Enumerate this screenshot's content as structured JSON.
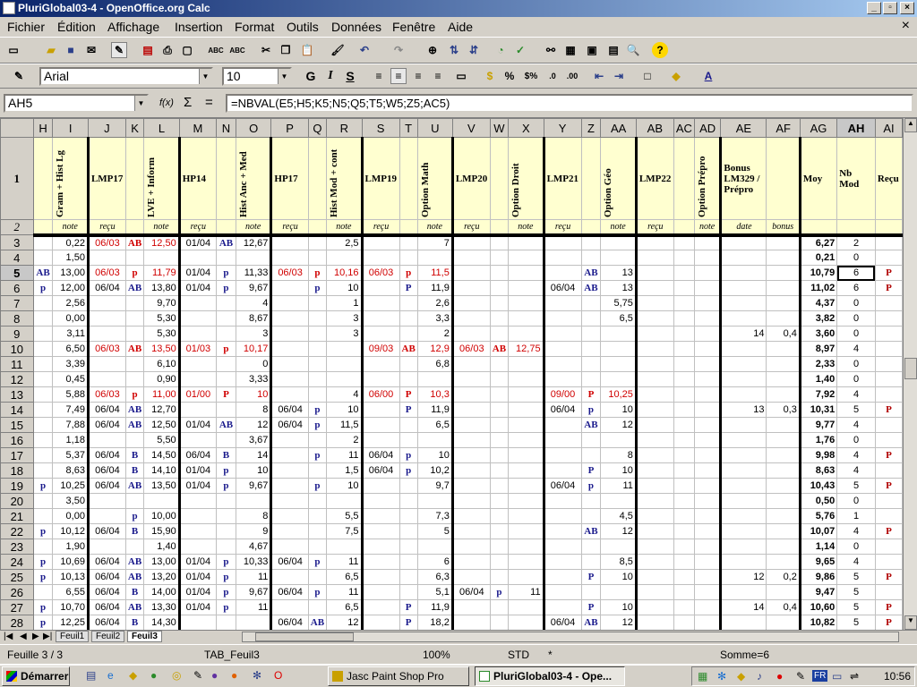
{
  "window": {
    "title": "PluriGlobal03-4 - OpenOffice.org Calc"
  },
  "menu": [
    "Fichier",
    "Édition",
    "Affichage",
    "Insertion",
    "Format",
    "Outils",
    "Données",
    "Fenêtre",
    "Aide"
  ],
  "format_bar": {
    "font": "Arial",
    "size": "10",
    "bold": "G",
    "italic": "I",
    "underline": "S",
    "percent": "%",
    "currency": "$%"
  },
  "formula_bar": {
    "cell_ref": "AH5",
    "fx": "f(x)",
    "sigma": "Σ",
    "equals": "=",
    "formula": "=NBVAL(E5;H5;K5;N5;Q5;T5;W5;Z5;AC5)"
  },
  "columns": [
    "H",
    "I",
    "J",
    "K",
    "L",
    "M",
    "N",
    "O",
    "P",
    "Q",
    "R",
    "S",
    "T",
    "U",
    "V",
    "W",
    "X",
    "Y",
    "Z",
    "AA",
    "AB",
    "AC",
    "AD",
    "AE",
    "AF",
    "AG",
    "AH",
    "AI"
  ],
  "header_row1": {
    "I": "Gram + Hist Lg",
    "J": "LMP17",
    "L": "LVE + Inform",
    "M": "HP14",
    "O": "Hist Anc + Med",
    "P": "HP17",
    "R": "Hist Mod + cont",
    "S": "LMP19",
    "U": "Option Math",
    "V": "LMP20",
    "X": "Option Droit",
    "Y": "LMP21",
    "AA": "Option Géo",
    "AB": "LMP22",
    "AD": "Option Prépro",
    "AE": "Bonus LM329 / Prépro",
    "AG": "Moy",
    "AH": "Nb Mod",
    "AI": "Reçu"
  },
  "header_row2": {
    "I": "note",
    "J": "reçu",
    "L": "note",
    "M": "reçu",
    "O": "note",
    "P": "reçu",
    "R": "note",
    "S": "reçu",
    "U": "note",
    "V": "reçu",
    "X": "note",
    "Y": "reçu",
    "AA": "note",
    "AB": "reçu",
    "AD": "note",
    "AE": "date",
    "AF": "bonus"
  },
  "rows": [
    {
      "n": "3",
      "I": "0,22",
      "J": "06/03",
      "K": "AB",
      "L": "12,50",
      "M": "01/04",
      "N": "AB",
      "O": "12,67",
      "R": "2,5",
      "U": "7",
      "AG": "6,27",
      "AH": "2"
    },
    {
      "n": "4",
      "I": "1,50",
      "AG": "0,21",
      "AH": "0"
    },
    {
      "n": "5",
      "H": "AB",
      "I": "13,00",
      "J": "06/03",
      "K": "p",
      "L": "11,79",
      "M": "01/04",
      "N": "p",
      "O": "11,33",
      "P": "06/03",
      "Q": "p",
      "R": "10,16",
      "S": "06/03",
      "T": "p",
      "U": "11,5",
      "Z": "AB",
      "AA": "13",
      "AG": "10,79",
      "AH": "6",
      "AI": "P"
    },
    {
      "n": "6",
      "H": "p",
      "I": "12,00",
      "J": "06/04",
      "K": "AB",
      "L": "13,80",
      "M": "01/04",
      "N": "p",
      "O": "9,67",
      "Q": "p",
      "R": "10",
      "T": "P",
      "U": "11,9",
      "Y": "06/04",
      "Z": "AB",
      "AA": "13",
      "AG": "11,02",
      "AH": "6",
      "AI": "P"
    },
    {
      "n": "7",
      "I": "2,56",
      "L": "9,70",
      "O": "4",
      "R": "1",
      "U": "2,6",
      "AA": "5,75",
      "AG": "4,37",
      "AH": "0"
    },
    {
      "n": "8",
      "I": "0,00",
      "L": "5,30",
      "O": "8,67",
      "R": "3",
      "U": "3,3",
      "AA": "6,5",
      "AG": "3,82",
      "AH": "0"
    },
    {
      "n": "9",
      "I": "3,11",
      "L": "5,30",
      "O": "3",
      "R": "3",
      "U": "2",
      "AE": "14",
      "AF": "0,4",
      "AG": "3,60",
      "AH": "0"
    },
    {
      "n": "10",
      "I": "6,50",
      "J": "06/03",
      "K": "AB",
      "L": "13,50",
      "M": "01/03",
      "N": "p",
      "O": "10,17",
      "S": "09/03",
      "T": "AB",
      "U": "12,9",
      "V": "06/03",
      "W": "AB",
      "X": "12,75",
      "AG": "8,97",
      "AH": "4"
    },
    {
      "n": "11",
      "I": "3,39",
      "L": "6,10",
      "O": "0",
      "U": "6,8",
      "AG": "2,33",
      "AH": "0"
    },
    {
      "n": "12",
      "I": "0,45",
      "L": "0,90",
      "O": "3,33",
      "AG": "1,40",
      "AH": "0"
    },
    {
      "n": "13",
      "I": "5,88",
      "J": "06/03",
      "K": "p",
      "L": "11,00",
      "M": "01/00",
      "N": "P",
      "O": "10",
      "R": "4",
      "S": "06/00",
      "T": "P",
      "U": "10,3",
      "Y": "09/00",
      "Z": "P",
      "AA": "10,25",
      "AG": "7,92",
      "AH": "4"
    },
    {
      "n": "14",
      "I": "7,49",
      "J": "06/04",
      "K": "AB",
      "L": "12,70",
      "O": "8",
      "P": "06/04",
      "Q": "p",
      "R": "10",
      "T": "P",
      "U": "11,9",
      "Y": "06/04",
      "Z": "p",
      "AA": "10",
      "AE": "13",
      "AF": "0,3",
      "AG": "10,31",
      "AH": "5",
      "AI": "P"
    },
    {
      "n": "15",
      "I": "7,88",
      "J": "06/04",
      "K": "AB",
      "L": "12,50",
      "M": "01/04",
      "N": "AB",
      "O": "12",
      "P": "06/04",
      "Q": "p",
      "R": "11,5",
      "U": "6,5",
      "Z": "AB",
      "AA": "12",
      "AG": "9,77",
      "AH": "4"
    },
    {
      "n": "16",
      "I": "1,18",
      "L": "5,50",
      "O": "3,67",
      "R": "2",
      "AG": "1,76",
      "AH": "0"
    },
    {
      "n": "17",
      "I": "5,37",
      "J": "06/04",
      "K": "B",
      "L": "14,50",
      "M": "06/04",
      "N": "B",
      "O": "14",
      "Q": "p",
      "R": "11",
      "S": "06/04",
      "T": "p",
      "U": "10",
      "AA": "8",
      "AG": "9,98",
      "AH": "4",
      "AI": "P"
    },
    {
      "n": "18",
      "I": "8,63",
      "J": "06/04",
      "K": "B",
      "L": "14,10",
      "M": "01/04",
      "N": "p",
      "O": "10",
      "R": "1,5",
      "S": "06/04",
      "T": "p",
      "U": "10,2",
      "Z": "P",
      "AA": "10",
      "AG": "8,63",
      "AH": "4"
    },
    {
      "n": "19",
      "H": "p",
      "I": "10,25",
      "J": "06/04",
      "K": "AB",
      "L": "13,50",
      "M": "01/04",
      "N": "p",
      "O": "9,67",
      "Q": "p",
      "R": "10",
      "U": "9,7",
      "Y": "06/04",
      "Z": "p",
      "AA": "11",
      "AG": "10,43",
      "AH": "5",
      "AI": "P"
    },
    {
      "n": "20",
      "I": "3,50",
      "AG": "0,50",
      "AH": "0"
    },
    {
      "n": "21",
      "I": "0,00",
      "K": "p",
      "L": "10,00",
      "O": "8",
      "R": "5,5",
      "U": "7,3",
      "AA": "4,5",
      "AG": "5,76",
      "AH": "1"
    },
    {
      "n": "22",
      "H": "p",
      "I": "10,12",
      "J": "06/04",
      "K": "B",
      "L": "15,90",
      "O": "9",
      "R": "7,5",
      "U": "5",
      "Z": "AB",
      "AA": "12",
      "AG": "10,07",
      "AH": "4",
      "AI": "P"
    },
    {
      "n": "23",
      "I": "1,90",
      "L": "1,40",
      "O": "4,67",
      "AG": "1,14",
      "AH": "0"
    },
    {
      "n": "24",
      "H": "p",
      "I": "10,69",
      "J": "06/04",
      "K": "AB",
      "L": "13,00",
      "M": "01/04",
      "N": "p",
      "O": "10,33",
      "P": "06/04",
      "Q": "p",
      "R": "11",
      "U": "6",
      "AA": "8,5",
      "AG": "9,65",
      "AH": "4"
    },
    {
      "n": "25",
      "H": "p",
      "I": "10,13",
      "J": "06/04",
      "K": "AB",
      "L": "13,20",
      "M": "01/04",
      "N": "p",
      "O": "11",
      "R": "6,5",
      "U": "6,3",
      "Z": "P",
      "AA": "10",
      "AE": "12",
      "AF": "0,2",
      "AG": "9,86",
      "AH": "5",
      "AI": "P"
    },
    {
      "n": "26",
      "I": "6,55",
      "J": "06/04",
      "K": "B",
      "L": "14,00",
      "M": "01/04",
      "N": "p",
      "O": "9,67",
      "P": "06/04",
      "Q": "p",
      "R": "11",
      "U": "5,1",
      "V": "06/04",
      "W": "p",
      "X": "11",
      "AG": "9,47",
      "AH": "5"
    },
    {
      "n": "27",
      "H": "p",
      "I": "10,70",
      "J": "06/04",
      "K": "AB",
      "L": "13,30",
      "M": "01/04",
      "N": "p",
      "O": "11",
      "R": "6,5",
      "T": "P",
      "U": "11,9",
      "Z": "P",
      "AA": "10",
      "AE": "14",
      "AF": "0,4",
      "AG": "10,60",
      "AH": "5",
      "AI": "P"
    },
    {
      "n": "28",
      "H": "p",
      "I": "12,25",
      "J": "06/04",
      "K": "B",
      "L": "14,30",
      "P": "06/04",
      "Q": "AB",
      "R": "12",
      "T": "P",
      "U": "18,2",
      "Y": "06/04",
      "Z": "AB",
      "AA": "12",
      "AG": "10,82",
      "AH": "5",
      "AI": "P"
    }
  ],
  "sheet_tabs": [
    "Feuil1",
    "Feuil2",
    "Feuil3"
  ],
  "active_tab": "Feuil3",
  "status": {
    "sheet": "Feuille 3 / 3",
    "style": "TAB_Feuil3",
    "zoom": "100%",
    "mode": "STD",
    "star": "*",
    "sum": "Somme=6"
  },
  "taskbar": {
    "start": "Démarrer",
    "task1": "Jasc Paint Shop Pro",
    "task2": "PluriGlobal03-4 - Ope...",
    "lang": "FR",
    "clock": "10:56"
  }
}
